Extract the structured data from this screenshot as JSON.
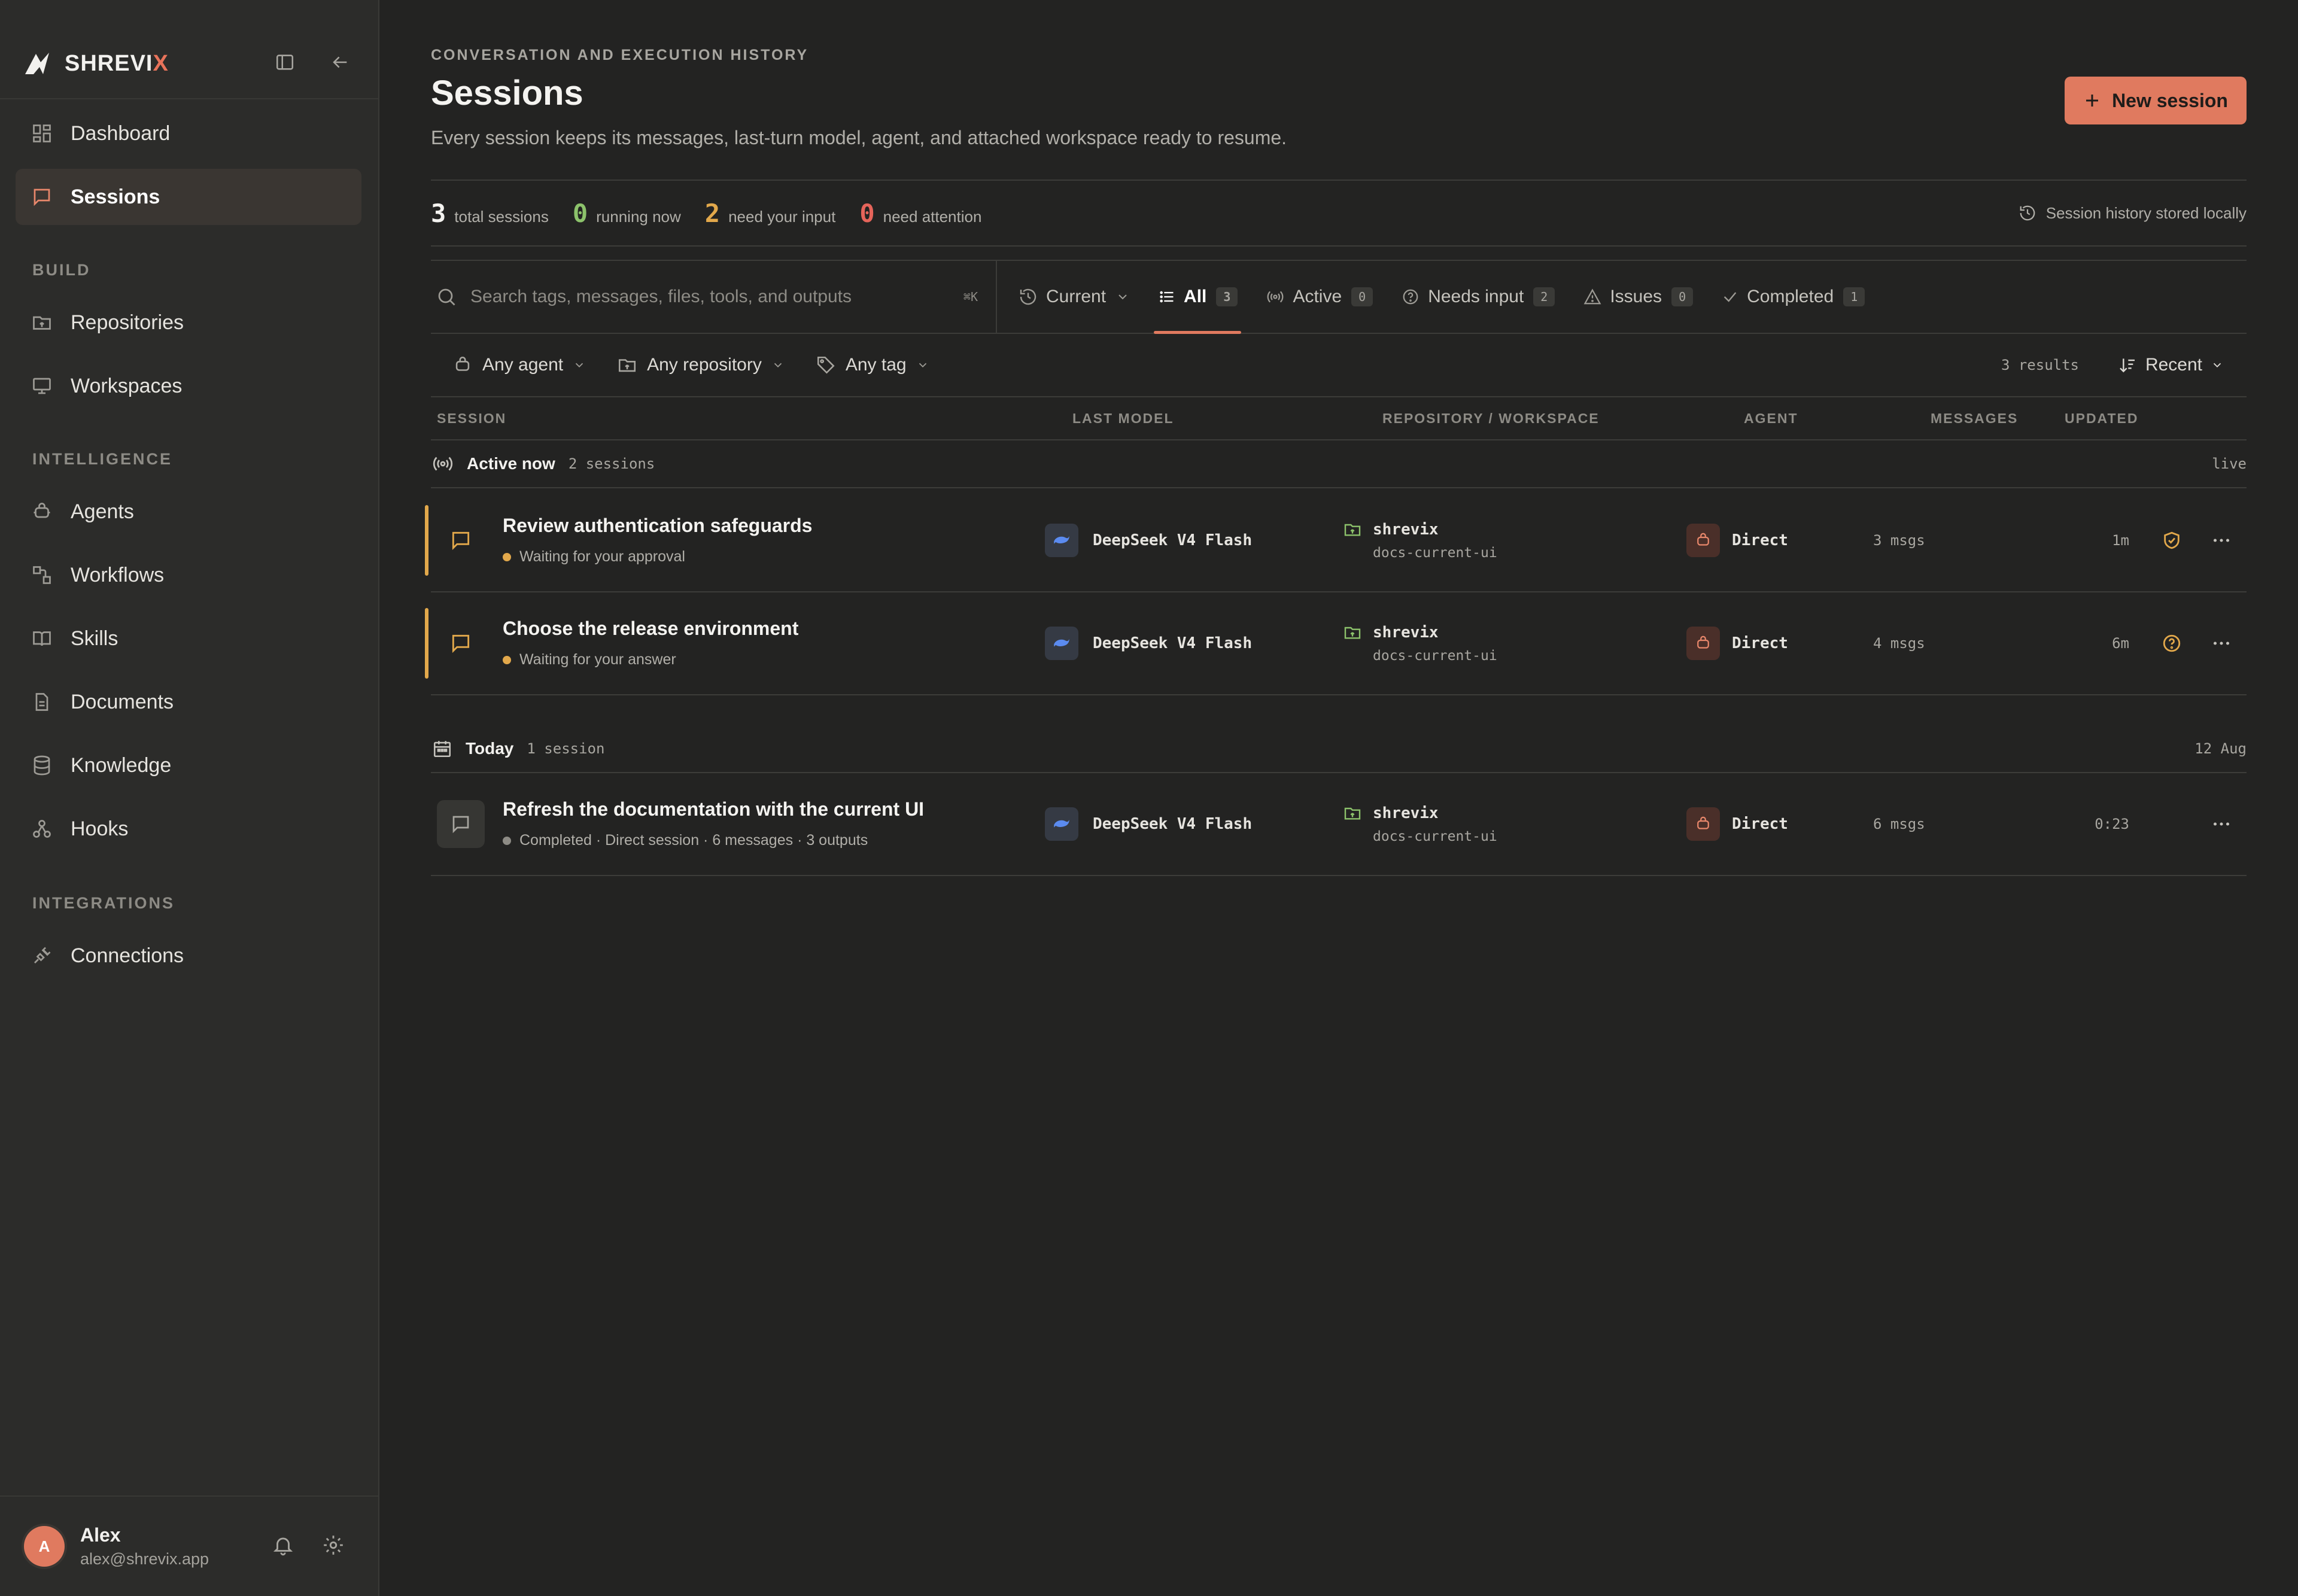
{
  "brand": {
    "name_main": "SHREVI",
    "name_accent": "X"
  },
  "sidebar": {
    "top_items": [
      {
        "label": "Dashboard"
      },
      {
        "label": "Sessions"
      }
    ],
    "sections": [
      {
        "label": "BUILD",
        "items": [
          {
            "label": "Repositories"
          },
          {
            "label": "Workspaces"
          }
        ]
      },
      {
        "label": "INTELLIGENCE",
        "items": [
          {
            "label": "Agents"
          },
          {
            "label": "Workflows"
          },
          {
            "label": "Skills"
          },
          {
            "label": "Documents"
          },
          {
            "label": "Knowledge"
          },
          {
            "label": "Hooks"
          }
        ]
      },
      {
        "label": "INTEGRATIONS",
        "items": [
          {
            "label": "Connections"
          }
        ]
      }
    ],
    "active_item": "Sessions"
  },
  "user": {
    "initial": "A",
    "name": "Alex",
    "email": "alex@shrevix.app"
  },
  "header": {
    "eyebrow": "CONVERSATION AND EXECUTION HISTORY",
    "title": "Sessions",
    "subtitle": "Every session keeps its messages, last-turn model, agent, and attached workspace ready to resume.",
    "new_button": "New session"
  },
  "stats": {
    "total": {
      "value": "3",
      "label": "total sessions"
    },
    "running": {
      "value": "0",
      "label": "running now"
    },
    "input": {
      "value": "2",
      "label": "need your input"
    },
    "attention": {
      "value": "0",
      "label": "need attention"
    },
    "note": "Session history stored locally"
  },
  "colors": {
    "accent": "#e07a5f",
    "running": "#8cc26b",
    "input": "#e2a84b",
    "attention": "#e5645a"
  },
  "search": {
    "placeholder": "Search tags, messages, files, tools, and outputs",
    "shortcut": "⌘K"
  },
  "scope": {
    "label": "Current"
  },
  "tabs": [
    {
      "label": "All",
      "count": "3"
    },
    {
      "label": "Active",
      "count": "0"
    },
    {
      "label": "Needs input",
      "count": "2"
    },
    {
      "label": "Issues",
      "count": "0"
    },
    {
      "label": "Completed",
      "count": "1"
    }
  ],
  "active_tab": "All",
  "filters": {
    "agent": "Any agent",
    "repository": "Any repository",
    "tag": "Any tag",
    "results": "3 results",
    "sort": "Recent"
  },
  "columns": {
    "session": "SESSION",
    "model": "LAST MODEL",
    "repo": "REPOSITORY / WORKSPACE",
    "agent": "AGENT",
    "messages": "MESSAGES",
    "updated": "UPDATED"
  },
  "groups": [
    {
      "title": "Active now",
      "count": "2 sessions",
      "right": "live",
      "rows": [
        {
          "title": "Review authentication safeguards",
          "status": "Waiting for your approval",
          "model": "DeepSeek V4 Flash",
          "repo": "shrevix",
          "workspace": "docs-current-ui",
          "agent": "Direct",
          "messages": "3 msgs",
          "updated": "1m",
          "state_icon": "shield-check-icon"
        },
        {
          "title": "Choose the release environment",
          "status": "Waiting for your answer",
          "model": "DeepSeek V4 Flash",
          "repo": "shrevix",
          "workspace": "docs-current-ui",
          "agent": "Direct",
          "messages": "4 msgs",
          "updated": "6m",
          "state_icon": "question-icon"
        }
      ]
    },
    {
      "title": "Today",
      "count": "1 session",
      "right": "12 Aug",
      "rows": [
        {
          "title": "Refresh the documentation with the current UI",
          "status": "Completed · Direct session · 6 messages · 3 outputs",
          "model": "DeepSeek V4 Flash",
          "repo": "shrevix",
          "workspace": "docs-current-ui",
          "agent": "Direct",
          "messages": "6 msgs",
          "updated": "0:23"
        }
      ]
    }
  ]
}
